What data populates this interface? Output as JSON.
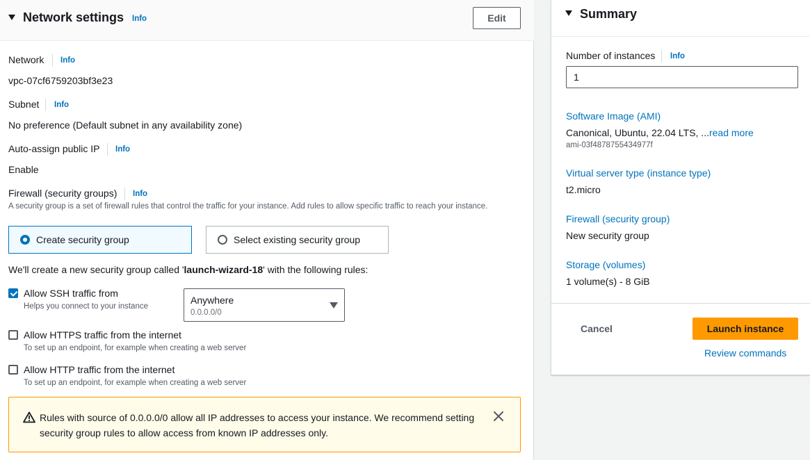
{
  "network_settings": {
    "title": "Network settings",
    "info_label": "Info",
    "edit_label": "Edit",
    "network_label": "Network",
    "network_value": "vpc-07cf6759203bf3e23",
    "subnet_label": "Subnet",
    "subnet_value": "No preference (Default subnet in any availability zone)",
    "auto_ip_label": "Auto-assign public IP",
    "auto_ip_value": "Enable",
    "firewall_label": "Firewall (security groups)",
    "firewall_desc": "A security group is a set of firewall rules that control the traffic for your instance. Add rules to allow specific traffic to reach your instance.",
    "radio_create": "Create security group",
    "radio_existing": "Select existing security group",
    "create_note_prefix": "We'll create a new security group called '",
    "create_note_name": "launch-wizard-18",
    "create_note_suffix": "' with the following rules:",
    "ssh_label": "Allow SSH traffic from",
    "ssh_desc": "Helps you connect to your instance",
    "ssh_source": "Anywhere",
    "ssh_source_cidr": "0.0.0.0/0",
    "https_label": "Allow HTTPS traffic from the internet",
    "https_desc": "To set up an endpoint, for example when creating a web server",
    "http_label": "Allow HTTP traffic from the internet",
    "http_desc": "To set up an endpoint, for example when creating a web server",
    "warning_text": "Rules with source of 0.0.0.0/0 allow all IP addresses to access your instance. We recommend setting security group rules to allow access from known IP addresses only."
  },
  "summary": {
    "title": "Summary",
    "info_label": "Info",
    "num_instances_label": "Number of instances",
    "num_instances_value": "1",
    "ami_link": "Software Image (AMI)",
    "ami_value": "Canonical, Ubuntu, 22.04 LTS, ...",
    "ami_read_more": "read more",
    "ami_id": "ami-03f4878755434977f",
    "instance_type_link": "Virtual server type (instance type)",
    "instance_type_value": "t2.micro",
    "firewall_link": "Firewall (security group)",
    "firewall_value": "New security group",
    "storage_link": "Storage (volumes)",
    "storage_value": "1 volume(s) - 8 GiB",
    "cancel_label": "Cancel",
    "launch_label": "Launch instance",
    "review_label": "Review commands"
  },
  "colors": {
    "link": "#0073bb",
    "primary_button": "#ff9900",
    "warning_bg": "#fffce9",
    "warning_border": "#ff9900"
  },
  "icons": {
    "warning": "warning-triangle-icon",
    "close": "close-icon",
    "expand": "caret-down-icon"
  }
}
